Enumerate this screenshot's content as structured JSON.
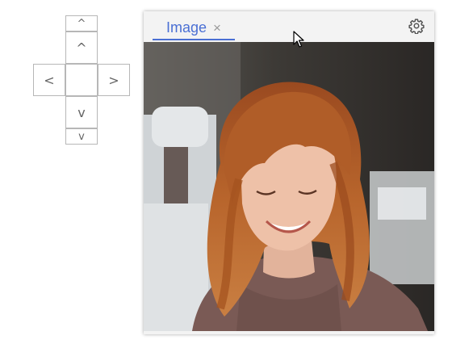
{
  "nav": {
    "up_small": "^",
    "up": "^",
    "left": "<",
    "center": "",
    "right": ">",
    "down": "v",
    "down_small": "v"
  },
  "panel": {
    "tab_label": "Image",
    "tab_close": "×",
    "settings_icon": "gear-icon"
  },
  "image": {
    "content": "photo of a smiling woman with wavy red hair",
    "accent_color": "#4a6fd4"
  }
}
